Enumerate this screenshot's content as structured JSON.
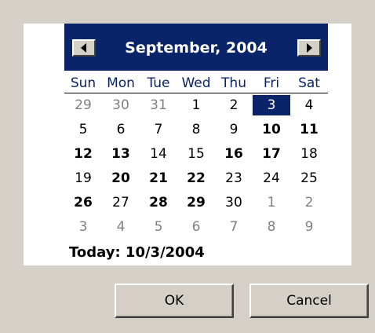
{
  "calendar": {
    "month_title": "September, 2004",
    "prev_icon": "left-arrow-icon",
    "next_icon": "right-arrow-icon",
    "weekdays": [
      "Sun",
      "Mon",
      "Tue",
      "Wed",
      "Thu",
      "Fri",
      "Sat"
    ],
    "weeks": [
      [
        {
          "d": "29",
          "other": true
        },
        {
          "d": "30",
          "other": true
        },
        {
          "d": "31",
          "other": true
        },
        {
          "d": "1"
        },
        {
          "d": "2"
        },
        {
          "d": "3",
          "selected": true
        },
        {
          "d": "4"
        }
      ],
      [
        {
          "d": "5"
        },
        {
          "d": "6"
        },
        {
          "d": "7"
        },
        {
          "d": "8"
        },
        {
          "d": "9"
        },
        {
          "d": "10",
          "bold": true
        },
        {
          "d": "11",
          "bold": true
        }
      ],
      [
        {
          "d": "12",
          "bold": true
        },
        {
          "d": "13",
          "bold": true
        },
        {
          "d": "14"
        },
        {
          "d": "15"
        },
        {
          "d": "16",
          "bold": true
        },
        {
          "d": "17",
          "bold": true
        },
        {
          "d": "18"
        }
      ],
      [
        {
          "d": "19"
        },
        {
          "d": "20",
          "bold": true
        },
        {
          "d": "21",
          "bold": true
        },
        {
          "d": "22",
          "bold": true
        },
        {
          "d": "23"
        },
        {
          "d": "24"
        },
        {
          "d": "25"
        }
      ],
      [
        {
          "d": "26",
          "bold": true
        },
        {
          "d": "27"
        },
        {
          "d": "28",
          "bold": true
        },
        {
          "d": "29",
          "bold": true
        },
        {
          "d": "30"
        },
        {
          "d": "1",
          "other": true
        },
        {
          "d": "2",
          "other": true
        }
      ],
      [
        {
          "d": "3",
          "other": true
        },
        {
          "d": "4",
          "other": true
        },
        {
          "d": "5",
          "other": true
        },
        {
          "d": "6",
          "other": true
        },
        {
          "d": "7",
          "other": true
        },
        {
          "d": "8",
          "other": true
        },
        {
          "d": "9",
          "other": true
        }
      ]
    ],
    "today_text": "Today: 10/3/2004"
  },
  "buttons": {
    "ok_label": "OK",
    "cancel_label": "Cancel"
  },
  "colors": {
    "header_bg": "#0a246a",
    "selected_bg": "#0a246a",
    "dialog_bg": "#d4d0c8",
    "other_month_text": "#808080"
  }
}
